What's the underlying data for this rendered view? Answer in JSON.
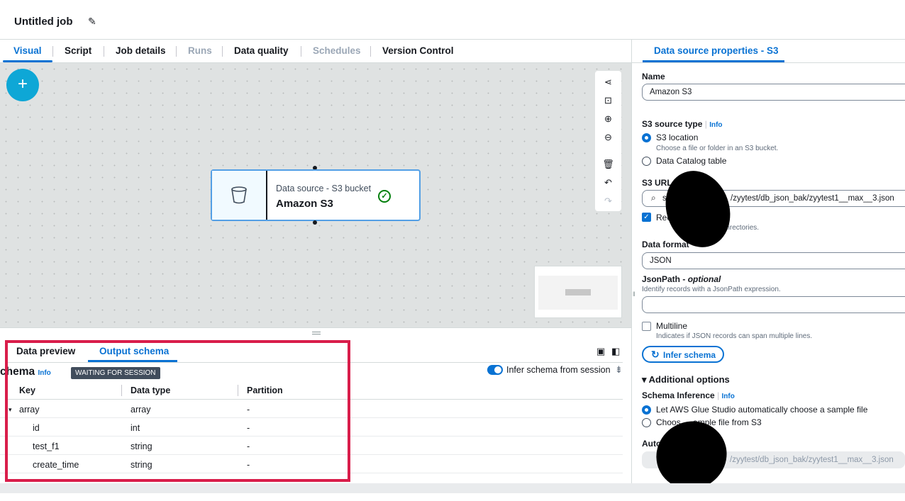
{
  "header": {
    "title": "Untitled job"
  },
  "tabs": [
    {
      "label": "Visual",
      "state": "active"
    },
    {
      "label": "Script",
      "state": "normal"
    },
    {
      "label": "Job details",
      "state": "normal"
    },
    {
      "label": "Runs",
      "state": "disabled"
    },
    {
      "label": "Data quality",
      "state": "normal"
    },
    {
      "label": "Schedules",
      "state": "disabled"
    },
    {
      "label": "Version Control",
      "state": "normal"
    }
  ],
  "canvas": {
    "add_button_label": "+",
    "node": {
      "kind": "Data source - S3 bucket",
      "name": "Amazon S3",
      "status": "valid"
    },
    "tools": [
      "share-icon",
      "fit-view-icon",
      "zoom-in-icon",
      "zoom-out-icon",
      "delete-icon",
      "undo-icon",
      "redo-icon"
    ]
  },
  "bottom": {
    "tabs": [
      {
        "label": "Data preview"
      },
      {
        "label": "Output schema"
      }
    ],
    "schema_title": "chema",
    "info": "Info",
    "badge": "WAITING FOR SESSION",
    "toggle_label": "Infer schema from session",
    "columns": [
      "Key",
      "Data type",
      "Partition"
    ],
    "rows": [
      {
        "key": "array",
        "type": "array",
        "partition": "-"
      },
      {
        "key": "id",
        "type": "int",
        "partition": "-"
      },
      {
        "key": "test_f1",
        "type": "string",
        "partition": "-"
      },
      {
        "key": "create_time",
        "type": "string",
        "partition": "-"
      }
    ]
  },
  "panel": {
    "tab": "Data source properties - S3",
    "name_label": "Name",
    "name_value": "Amazon S3",
    "source_type_label": "S3 source type",
    "info": "Info",
    "opt_s3_location": "S3 location",
    "opt_s3_location_desc": "Choose a file or folder in an S3 bucket.",
    "opt_catalog": "Data Catalog table",
    "url_label": "S3 URL",
    "url_value_prefix": "s3",
    "url_value": "/zyytest/db_json_bak/zyytest1__max__3.json",
    "recursive_label": "Recu",
    "recursive_desc": "ubdirectories.",
    "format_label": "Data format",
    "format_value": "JSON",
    "jsonpath_label": "JsonPath - ",
    "jsonpath_optional": "optional",
    "jsonpath_desc": "Identify records with a JsonPath expression.",
    "multiline_label": "Multiline",
    "multiline_desc": "Indicates if JSON records can span multiple lines.",
    "infer_button": "Infer schema",
    "additional": "Additional options",
    "inference_label": "Schema Inference",
    "inf_opt1": "Let AWS Glue Studio automatically choose a sample file",
    "inf_opt2_a": "Choos",
    "inf_opt2_b": "ample file from S3",
    "auto_label": "Auto",
    "auto_value": "/zyytest/db_json_bak/zyytest1__max__3.json"
  }
}
